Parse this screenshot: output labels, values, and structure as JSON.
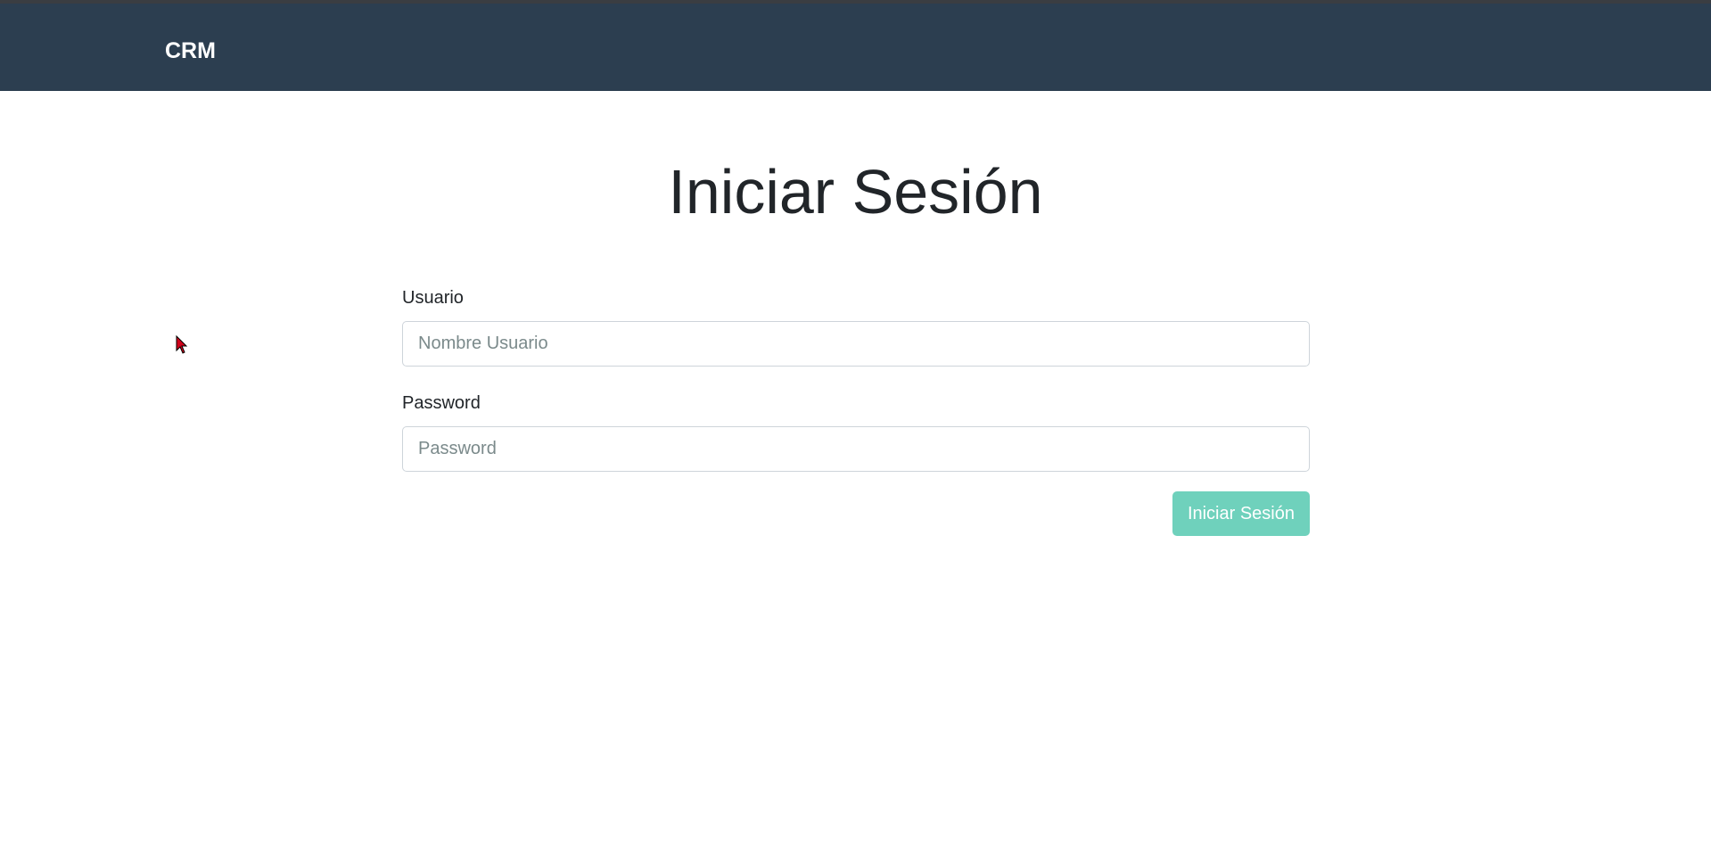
{
  "navbar": {
    "brand": "CRM"
  },
  "main": {
    "title": "Iniciar Sesión",
    "form": {
      "username": {
        "label": "Usuario",
        "placeholder": "Nombre Usuario",
        "value": ""
      },
      "password": {
        "label": "Password",
        "placeholder": "Password",
        "value": ""
      },
      "submit_label": "Iniciar Sesión"
    }
  },
  "colors": {
    "navbar": "#2c3e50",
    "button": "#6fd1bc",
    "text": "#212529"
  },
  "icons": {
    "cursor": "mouse-pointer-icon"
  }
}
